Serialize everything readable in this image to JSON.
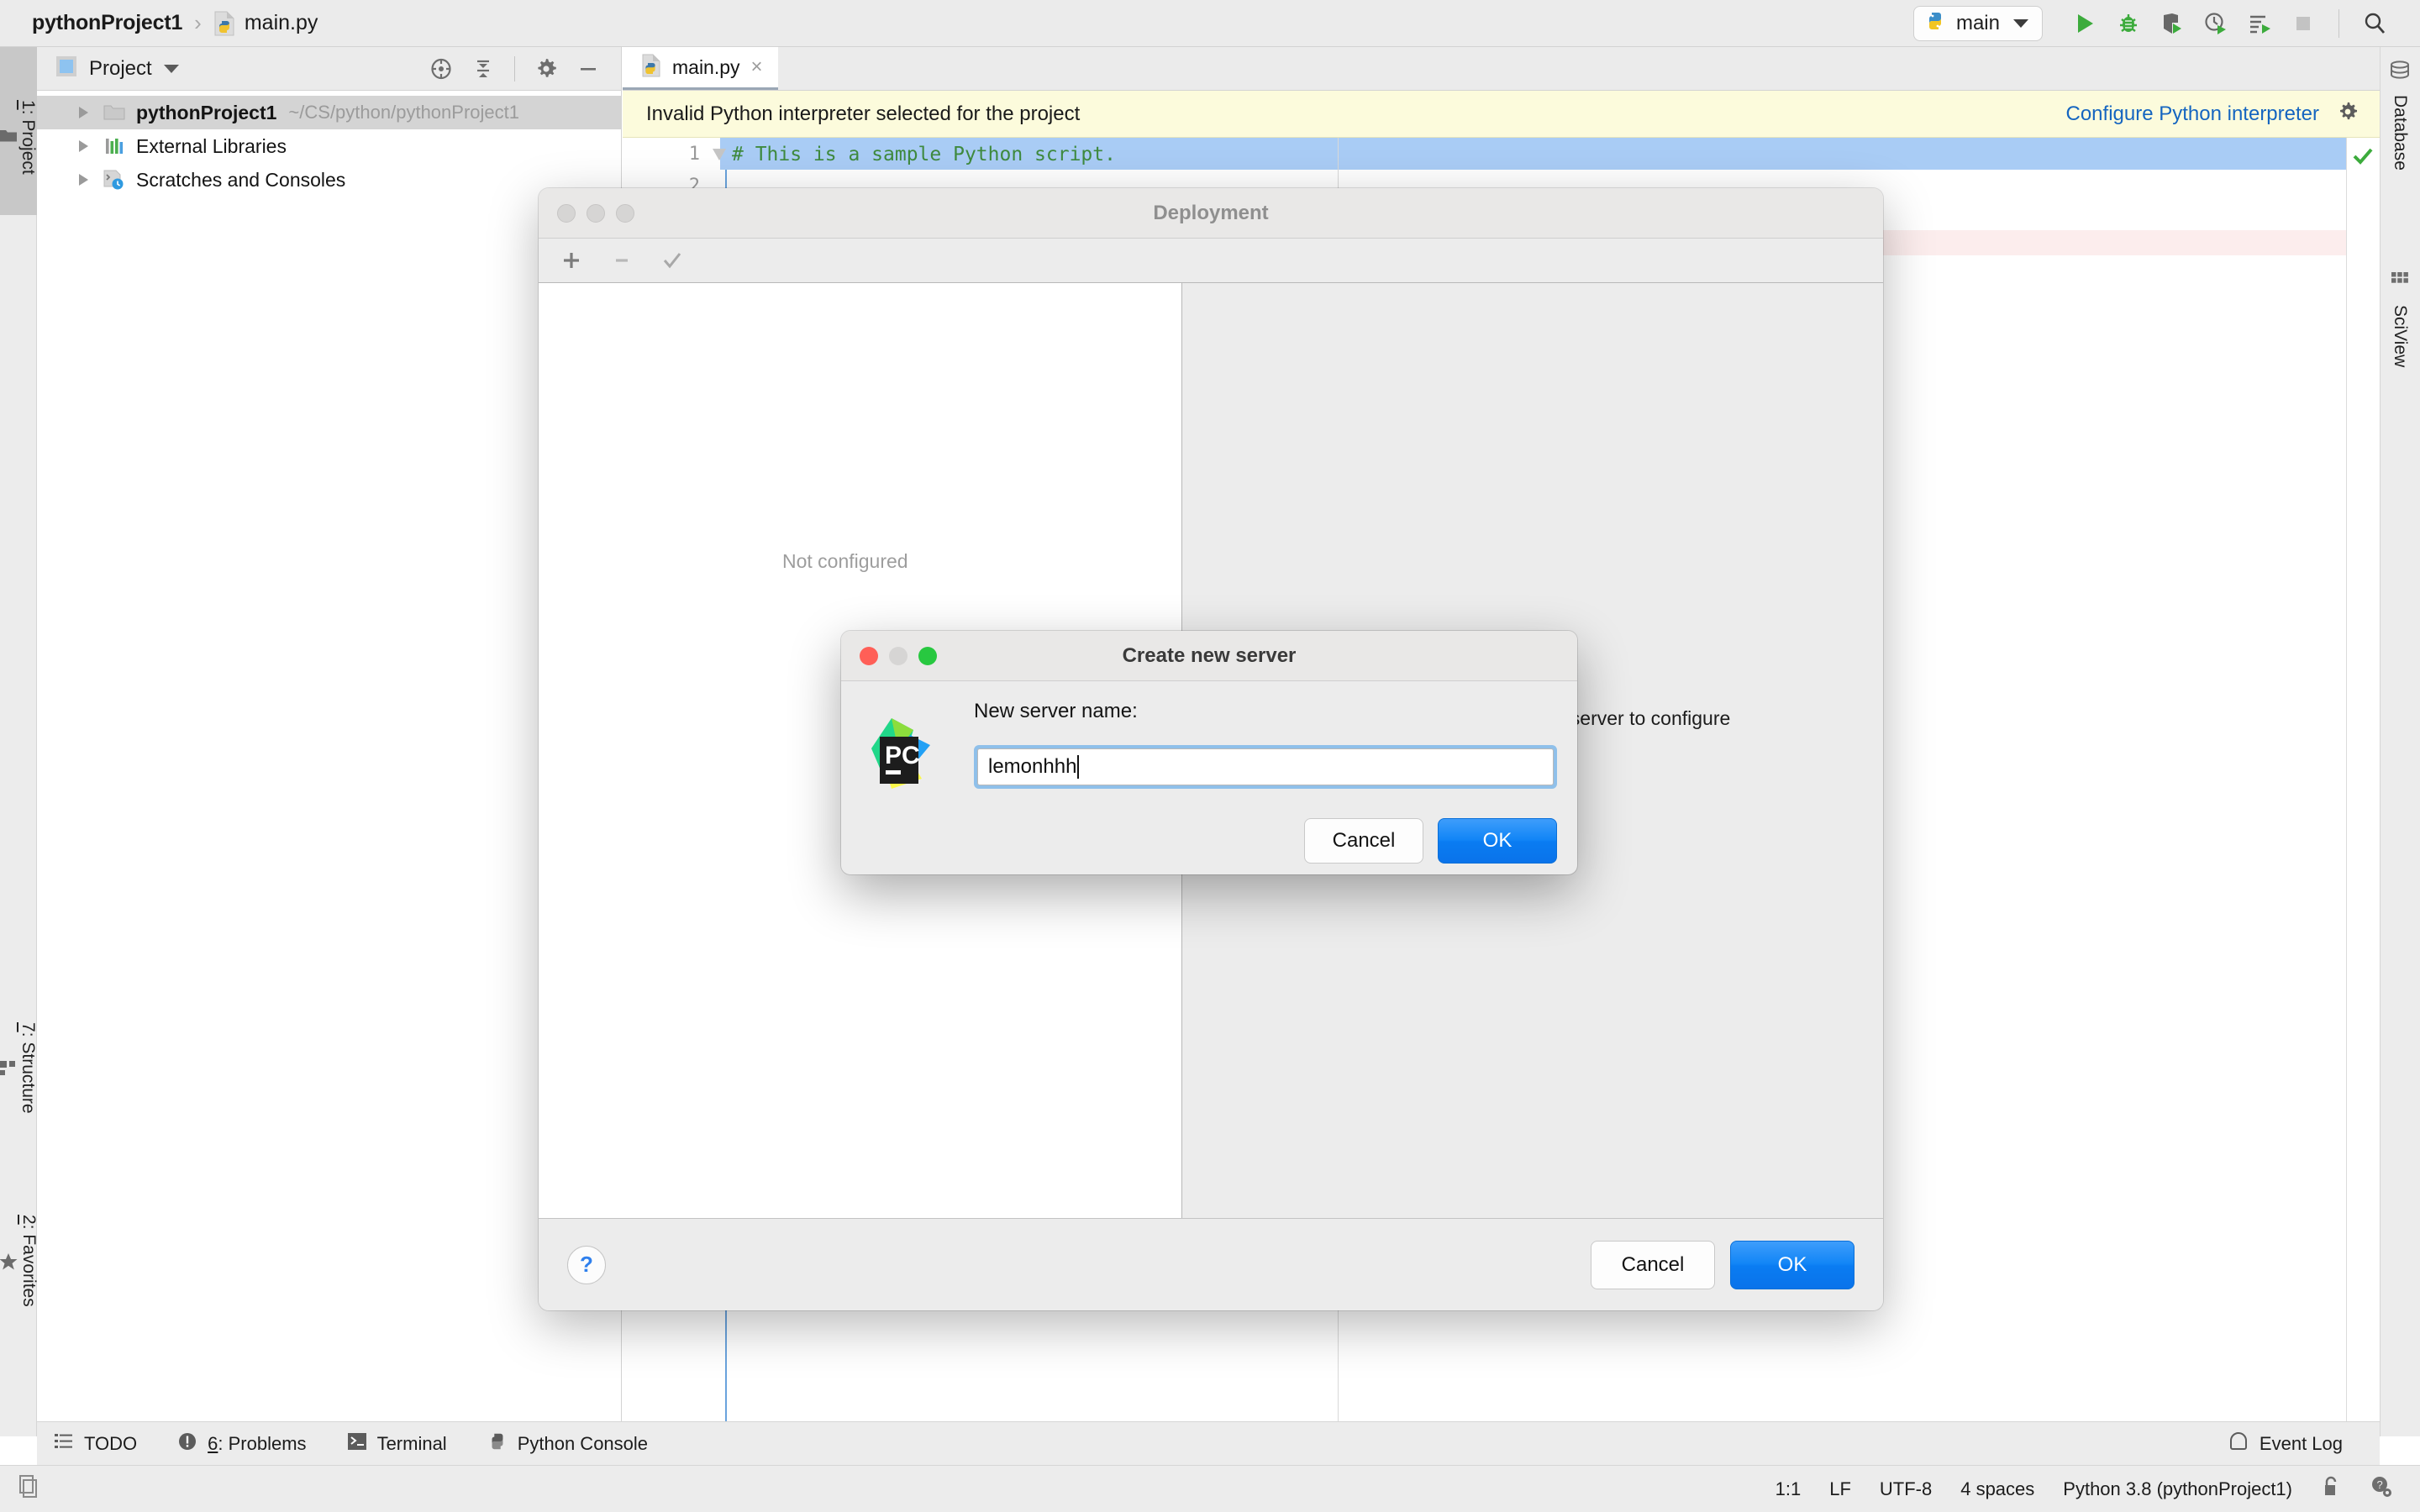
{
  "window": {
    "breadcrumb": {
      "project": "pythonProject1",
      "separator": "›",
      "file": "main.py",
      "file_icon": "python-file-icon"
    }
  },
  "toolbar": {
    "run_config": {
      "label": "main",
      "icon": "python-icon",
      "caret": "chevron-down-icon"
    },
    "buttons": [
      {
        "name": "run-button",
        "icon": "play-icon"
      },
      {
        "name": "debug-button",
        "icon": "bug-icon"
      },
      {
        "name": "run-with-coverage-button",
        "icon": "shield-run-icon"
      },
      {
        "name": "profile-button",
        "icon": "clock-run-icon"
      },
      {
        "name": "run-with-profiler-button",
        "icon": "list-run-icon"
      },
      {
        "name": "stop-button",
        "icon": "stop-square-icon"
      }
    ],
    "search_icon": "search-icon"
  },
  "left_stripe": {
    "tabs": [
      {
        "name": "project",
        "label_prefix": "1",
        "label": ": Project",
        "icon": "folder-icon",
        "selected": true
      },
      {
        "name": "structure",
        "label_prefix": "7",
        "label": ": Structure",
        "icon": "structure-icon",
        "selected": false
      },
      {
        "name": "favorites",
        "label_prefix": "2",
        "label": ": Favorites",
        "icon": "star-icon",
        "selected": false
      }
    ]
  },
  "right_stripe": {
    "tabs": [
      {
        "name": "database",
        "label": "Database",
        "icon": "database-icon"
      },
      {
        "name": "sciview",
        "label": "SciView",
        "icon": "grid-icon"
      }
    ]
  },
  "project_panel": {
    "title": "Project",
    "caret": "chevron-down-icon",
    "tools": [
      {
        "name": "select-opened-file",
        "icon": "target-icon"
      },
      {
        "name": "collapse-all",
        "icon": "collapse-all-icon"
      },
      {
        "name": "settings",
        "icon": "gear-icon"
      },
      {
        "name": "hide",
        "icon": "minus-icon"
      }
    ],
    "tree": [
      {
        "label": "pythonProject1",
        "path": "~/CS/python/pythonProject1",
        "icon": "folder-icon",
        "bold": true,
        "selected": true
      },
      {
        "label": "External Libraries",
        "path": "",
        "icon": "libraries-icon",
        "bold": false,
        "selected": false
      },
      {
        "label": "Scratches and Consoles",
        "path": "",
        "icon": "scratches-icon",
        "bold": false,
        "selected": false
      }
    ]
  },
  "editor": {
    "tab": {
      "name": "main.py",
      "icon": "python-file-icon",
      "close": "×"
    },
    "banner": {
      "message": "Invalid Python interpreter selected for the project",
      "link": "Configure Python interpreter",
      "gear_icon": "gear-icon"
    },
    "lines": [
      {
        "number": "1",
        "text": "# This is a sample Python script.",
        "highlighted": true
      },
      {
        "number": "2",
        "text": "",
        "highlighted": false
      }
    ],
    "inspection_status_icon": "checkmark-ok-icon"
  },
  "deployment_window": {
    "title": "Deployment",
    "toolbar": [
      {
        "name": "add-server-button",
        "icon": "plus-icon"
      },
      {
        "name": "remove-server-button",
        "icon": "minus-icon"
      },
      {
        "name": "set-default-button",
        "icon": "checkmark-icon"
      }
    ],
    "left_placeholder": "Not configured",
    "right_hint": "Add a deployment server to configure",
    "help_icon": "question-mark-icon",
    "cancel_label": "Cancel",
    "ok_label": "OK"
  },
  "create_server_dialog": {
    "title": "Create new server",
    "logo": "pycharm-logo-icon",
    "field_label": "New server name:",
    "field_value": "lemonhhh",
    "field_placeholder": "",
    "cancel_label": "Cancel",
    "ok_label": "OK",
    "traffic_lights": {
      "close": "close-traffic-light",
      "minimize": "minimize-traffic-light",
      "zoom": "zoom-traffic-light"
    }
  },
  "tool_window_bar": {
    "items": [
      {
        "name": "todo",
        "label": "TODO",
        "icon": "list-icon"
      },
      {
        "name": "problems",
        "label_prefix": "6",
        "label": ": Problems",
        "icon": "error-circle-icon"
      },
      {
        "name": "terminal",
        "label": "Terminal",
        "icon": "terminal-icon"
      },
      {
        "name": "python-console",
        "label": "Python Console",
        "icon": "python-icon"
      }
    ],
    "event_log": {
      "label": "Event Log",
      "icon": "event-log-icon"
    }
  },
  "status_bar": {
    "items": [
      {
        "name": "caret-position",
        "label": "1:1"
      },
      {
        "name": "line-separator",
        "label": "LF"
      },
      {
        "name": "encoding",
        "label": "UTF-8"
      },
      {
        "name": "indent",
        "label": "4 spaces"
      },
      {
        "name": "interpreter",
        "label": "Python 3.8 (pythonProject1)"
      }
    ],
    "lock_icon": "unlocked-icon",
    "help_icon": "help-gear-icon"
  },
  "colors": {
    "accent_blue": "#0a7cf2",
    "link_blue": "#1565c0",
    "banner_yellow": "#fcfbdc",
    "selection_blue": "#a9ccf5",
    "error_pink": "#fceded",
    "comment_green": "#3f8a3f",
    "chrome_gray": "#ececec"
  }
}
